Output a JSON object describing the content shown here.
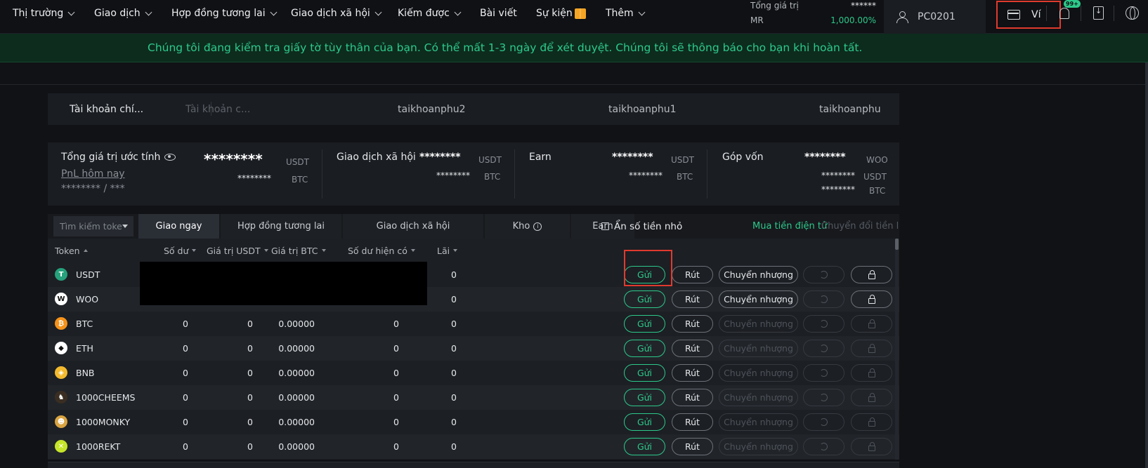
{
  "nav": {
    "items": [
      {
        "label": "Thị trường",
        "dropdown": true
      },
      {
        "label": "Giao dịch",
        "dropdown": true
      },
      {
        "label": "Hợp đồng tương lai",
        "dropdown": true
      },
      {
        "label": "Giao dịch xã hội",
        "dropdown": true
      },
      {
        "label": "Kiếm được",
        "dropdown": true
      },
      {
        "label": "Bài viết",
        "dropdown": false
      },
      {
        "label": "Sự kiện",
        "dropdown": false
      },
      {
        "label": "Thêm",
        "dropdown": true
      }
    ],
    "total_value_label": "Tổng giá trị",
    "total_value": "******",
    "mr_label": "MR",
    "mr_value": "1,000.00%",
    "account_name": "PC0201",
    "wallet_label": "Ví",
    "notification_badge": "99+"
  },
  "notice": "Chúng tôi đang kiểm tra giấy tờ tùy thân của bạn. Có thể mất 1-3 ngày để xét duyệt. Chúng tôi sẽ thông báo cho bạn khi hoàn tất.",
  "subaccounts": [
    "Tài khoản chí...",
    "Tài khoản c...",
    "taikhoanphu2",
    "taikhoanphu1",
    "taikhoanphu"
  ],
  "summary": {
    "total_label": "Tổng giá trị ước tính",
    "total_usdt": "********",
    "total_btc": "********",
    "pnl_label": "PnL hôm nay",
    "pnl_value": "******** / ***",
    "social_label": "Giao dịch xã hội",
    "social_usdt": "********",
    "social_btc": "********",
    "earn_label": "Earn",
    "earn_usdt": "********",
    "earn_btc": "********",
    "capital_label": "Góp vốn",
    "capital_woo": "********",
    "capital_usdt": "********",
    "capital_btc": "********",
    "unit_usdt": "USDT",
    "unit_btc": "BTC",
    "unit_woo": "WOO"
  },
  "asset_tabs": {
    "search_placeholder": "Tìm kiếm toke",
    "tabs": [
      "Giao ngay",
      "Hợp đồng tương lai",
      "Giao dịch xã hội",
      "Kho",
      "Earn"
    ],
    "hide_small": "Ẩn số tiền nhỏ",
    "buy_crypto": "Mua tiền điện tử",
    "convert_small": "Chuyển đổi tiền lẻ"
  },
  "table": {
    "headers": [
      "Token",
      "Số dư",
      "Giá trị USDT",
      "Giá trị BTC",
      "Số dư hiện có",
      "Lãi"
    ],
    "buttons": {
      "send": "Gửi",
      "withdraw": "Rút",
      "transfer": "Chuyển nhượng"
    },
    "rows": [
      {
        "token": "USDT",
        "balance": "",
        "usdt": "",
        "btc": "",
        "available": "",
        "interest": "0",
        "color": "#26a17b",
        "glyph": "T",
        "transfer_enabled": true
      },
      {
        "token": "WOO",
        "balance": "",
        "usdt": "",
        "btc": "",
        "available": "",
        "interest": "0",
        "color": "#ffffff",
        "glyph": "W",
        "transfer_enabled": true
      },
      {
        "token": "BTC",
        "balance": "0",
        "usdt": "0",
        "btc": "0.00000",
        "available": "0",
        "interest": "0",
        "color": "#f7931a",
        "glyph": "₿",
        "transfer_enabled": false
      },
      {
        "token": "ETH",
        "balance": "0",
        "usdt": "0",
        "btc": "0.00000",
        "available": "0",
        "interest": "0",
        "color": "#ffffff",
        "glyph": "◆",
        "transfer_enabled": false
      },
      {
        "token": "BNB",
        "balance": "0",
        "usdt": "0",
        "btc": "0.00000",
        "available": "0",
        "interest": "0",
        "color": "#f3ba2f",
        "glyph": "◈",
        "transfer_enabled": false
      },
      {
        "token": "1000CHEEMS",
        "balance": "0",
        "usdt": "0",
        "btc": "0.00000",
        "available": "0",
        "interest": "0",
        "color": "#3a2e22",
        "glyph": "♞",
        "transfer_enabled": false
      },
      {
        "token": "1000MONKY",
        "balance": "0",
        "usdt": "0",
        "btc": "0.00000",
        "available": "0",
        "interest": "0",
        "color": "#d9a441",
        "glyph": "☻",
        "transfer_enabled": false
      },
      {
        "token": "1000REKT",
        "balance": "0",
        "usdt": "0",
        "btc": "0.00000",
        "available": "0",
        "interest": "0",
        "color": "#c6e52a",
        "glyph": "✕",
        "transfer_enabled": false
      }
    ]
  }
}
